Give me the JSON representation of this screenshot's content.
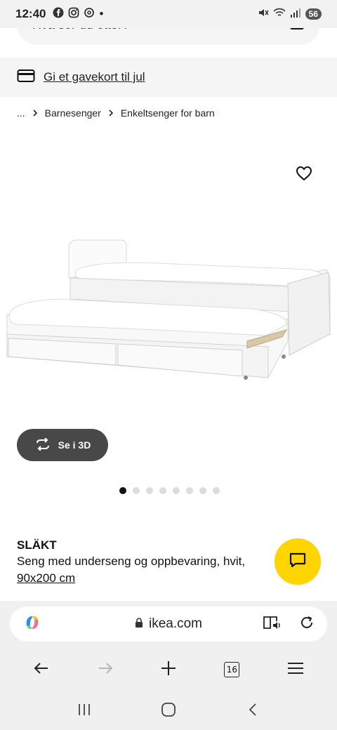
{
  "status_bar": {
    "time": "12:40",
    "dot": "•",
    "battery": "56",
    "icons": [
      "facebook-icon",
      "instagram-icon",
      "threads-icon",
      "mute-icon",
      "wifi-icon",
      "signal-icon"
    ]
  },
  "search": {
    "placeholder": "Hva ser du etter?"
  },
  "gift_banner": {
    "label": "Gi et gavekort til jul"
  },
  "breadcrumb": {
    "ellipsis": "...",
    "items": [
      "Barnesenger",
      "Enkeltsenger for barn"
    ]
  },
  "gallery": {
    "view3d_label": "Se i 3D",
    "total_images": 8,
    "active_index": 0
  },
  "product": {
    "name": "SLÄKT",
    "description": "Seng med underseng og oppbevaring, hvit,",
    "size": "90x200 cm"
  },
  "browser": {
    "url": "ikea.com",
    "tab_count": "16"
  },
  "colors": {
    "chat_button": "#ffd500",
    "view3d_button": "#484848",
    "active_dot": "#111111"
  }
}
